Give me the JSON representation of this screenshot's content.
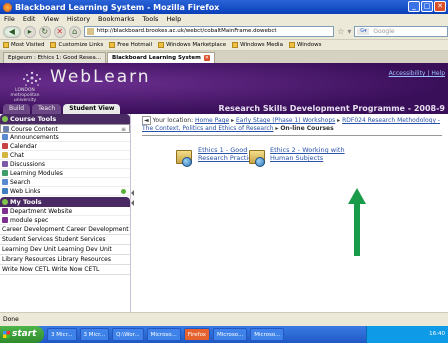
{
  "window": {
    "title": "Blackboard Learning System - Mozilla Firefox",
    "controls": [
      "_",
      "□",
      "✕"
    ]
  },
  "menubar": [
    "File",
    "Edit",
    "View",
    "History",
    "Bookmarks",
    "Tools",
    "Help"
  ],
  "navbar": {
    "url": "http://blackboard.brookes.ac.uk/webct/cobaltMainFrame.dowebct",
    "search_placeholder": "Google"
  },
  "bookmarks": [
    "Most Visited",
    "Customize Links",
    "Free Hotmail",
    "Windows Marketplace",
    "Windows Media",
    "Windows"
  ],
  "tabs": [
    {
      "label": "Epigeum : Ethics 1: Good Resea...",
      "active": false
    },
    {
      "label": "Blackboard Learning System",
      "active": true
    }
  ],
  "banner": {
    "logo_text": "WebLearn",
    "university": "LONDON metropolitan university",
    "accessibility": "Accessibility | Help",
    "programme": "Research Skills Development Programme - 2008-9",
    "buttons": [
      "Build",
      "Teach",
      "Student View"
    ]
  },
  "sidebar": {
    "course_tools_header": "Course Tools",
    "course_tools": [
      {
        "label": "Course Content",
        "selected": true,
        "icon_color": "#6a7fb0"
      },
      {
        "label": "Announcements",
        "selected": false,
        "icon_color": "#5a8bd1"
      },
      {
        "label": "Calendar",
        "selected": false,
        "icon_color": "#c84040"
      },
      {
        "label": "Chat",
        "selected": false,
        "icon_color": "#d6b440"
      },
      {
        "label": "Discussions",
        "selected": false,
        "icon_color": "#7c5aa8"
      },
      {
        "label": "Learning Modules",
        "selected": false,
        "icon_color": "#3f9d6a"
      },
      {
        "label": "Search",
        "selected": false,
        "icon_color": "#5a8bd1"
      },
      {
        "label": "Web Links",
        "selected": false,
        "icon_color": "#3f7fbf"
      }
    ],
    "my_tools_header": "My Tools",
    "my_tools": [
      {
        "label": "Department Website",
        "icon_color": "#7c2f8e"
      },
      {
        "label": "module spec",
        "icon_color": "#7c2f8e"
      }
    ],
    "links": [
      "Career Development Career Development",
      "Student Services Student Services",
      "Learning Dev Unit Learning Dev Unit",
      "Library Resources Library Resources",
      "Write Now CETL Write Now CETL"
    ]
  },
  "content": {
    "location_label": "Your location:",
    "crumbs": [
      "Home Page",
      "Early Stage (Phase 1) Workshops",
      "RDF024 Research Methodology - The Context, Politics and Ethics of Research"
    ],
    "current": "On-line Courses",
    "courses": [
      "Ethics 1 - Good Research Practice",
      "Ethics 2 - Working with Human Subjects"
    ]
  },
  "statusbar": {
    "text": "Done"
  },
  "taskbar": {
    "start": "start",
    "tasks": [
      "3 Micr...",
      "3 Micr...",
      "Q:\\Wor...",
      "Microso...",
      "Firefox",
      "Microso...",
      "Microso..."
    ],
    "clock": "16:40"
  },
  "colors": {
    "arrow": "#1a9b4a",
    "banner": "#4a1a6e",
    "link": "#2a52a8"
  }
}
